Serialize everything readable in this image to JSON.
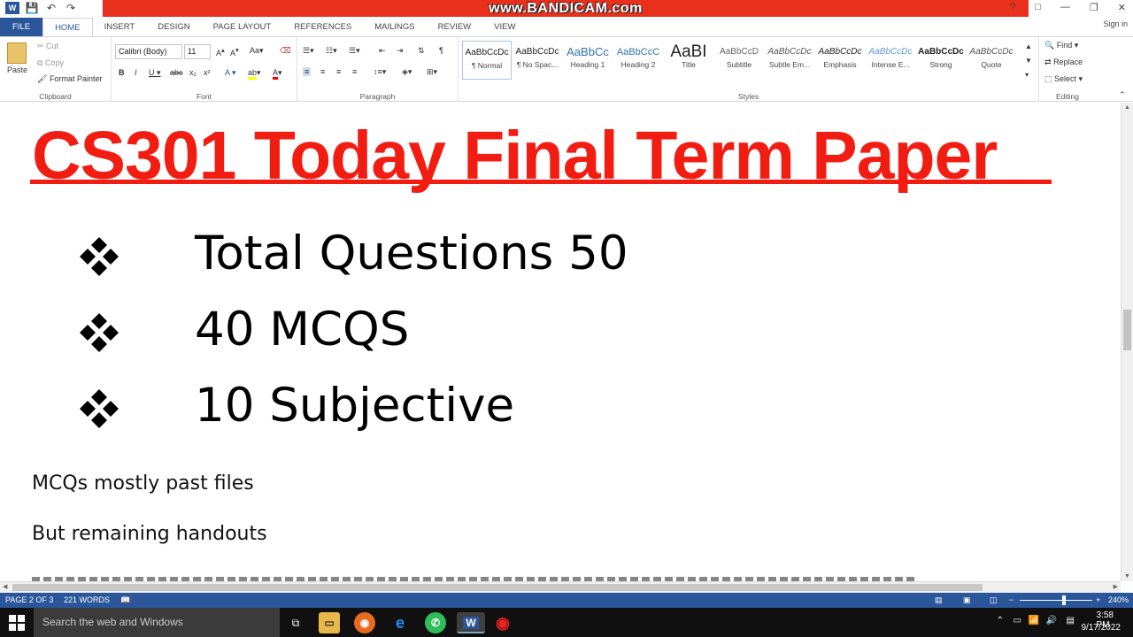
{
  "window": {
    "watermark": "www.BANDICAM.com",
    "signin": "Sign in",
    "controls": [
      "?",
      "□",
      "—",
      "❐",
      "✕"
    ]
  },
  "tabs": [
    "FILE",
    "HOME",
    "INSERT",
    "DESIGN",
    "PAGE LAYOUT",
    "REFERENCES",
    "MAILINGS",
    "REVIEW",
    "VIEW"
  ],
  "ribbon": {
    "clipboard": {
      "label": "Clipboard",
      "paste": "Paste",
      "cut": "Cut",
      "copy": "Copy",
      "format_painter": "Format Painter"
    },
    "font": {
      "label": "Font",
      "font_name": "Calibri (Body)",
      "font_size": "11"
    },
    "paragraph": {
      "label": "Paragraph"
    },
    "styles": {
      "label": "Styles",
      "items": [
        {
          "sample": "AaBbCcDc",
          "name": "¶ Normal"
        },
        {
          "sample": "AaBbCcDc",
          "name": "¶ No Spac..."
        },
        {
          "sample": "AaBbCc",
          "name": "Heading 1"
        },
        {
          "sample": "AaBbCcC",
          "name": "Heading 2"
        },
        {
          "sample": "AaBI",
          "name": "Title"
        },
        {
          "sample": "AaBbCcD",
          "name": "Subtitle"
        },
        {
          "sample": "AaBbCcDc",
          "name": "Subtle Em..."
        },
        {
          "sample": "AaBbCcDc",
          "name": "Emphasis"
        },
        {
          "sample": "AaBbCcDc",
          "name": "Intense E..."
        },
        {
          "sample": "AaBbCcDc",
          "name": "Strong"
        },
        {
          "sample": "AaBbCcDc",
          "name": "Quote"
        }
      ]
    },
    "editing": {
      "label": "Editing",
      "find": "Find",
      "replace": "Replace",
      "select": "Select"
    }
  },
  "document": {
    "title": "CS301 Today Final Term Paper",
    "bullets": [
      "Total Questions 50",
      "40 MCQS",
      "10 Subjective"
    ],
    "paragraphs": [
      "MCQs mostly past files",
      "But remaining handouts"
    ]
  },
  "status": {
    "page": "PAGE 2 OF 3",
    "words": "221 WORDS",
    "zoom": "240%"
  },
  "taskbar": {
    "search_placeholder": "Search the web and Windows",
    "time": "3:58 PM",
    "date": "9/17/2022"
  }
}
